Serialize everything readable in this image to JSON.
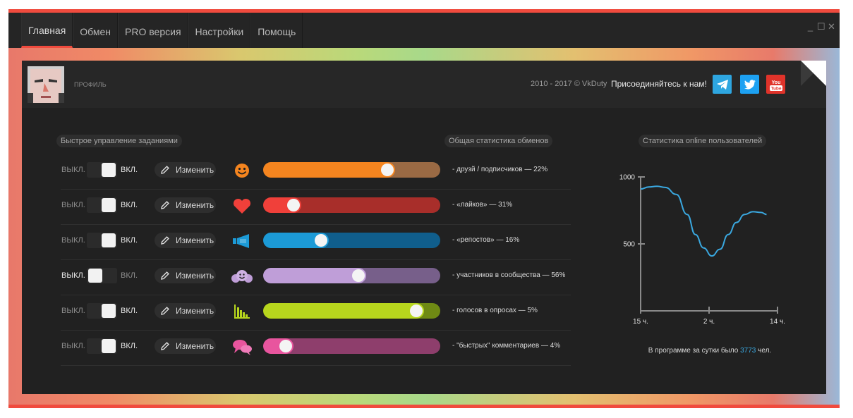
{
  "nav": {
    "tabs": [
      {
        "label": "Главная",
        "active": true
      },
      {
        "label": "Обмен",
        "active": false
      },
      {
        "label": "PRO версия",
        "active": false
      },
      {
        "label": "Настройки",
        "active": false
      },
      {
        "label": "Помощь",
        "active": false
      }
    ],
    "window_controls": [
      "_",
      "☐",
      "✕"
    ]
  },
  "header": {
    "profile_label": "ПРОФИЛЬ",
    "copyright": "2010 - 2017 © VkDuty",
    "join_text": "Присоединяйтесь к нам!",
    "social": [
      {
        "name": "telegram-icon",
        "color": "#2ea6e0"
      },
      {
        "name": "twitter-icon",
        "color": "#1da1f2"
      },
      {
        "name": "youtube-icon",
        "color": "#e0332a",
        "text": "You Tube"
      }
    ]
  },
  "sections": {
    "quick_control": "Быстрое управление заданиями",
    "exchange_stats": "Общая статистика обменов",
    "online_stats": "Статистика online пользователей"
  },
  "labels": {
    "off": "ВЫКЛ.",
    "on": "ВКЛ.",
    "edit": "Изменить"
  },
  "tasks": [
    {
      "icon": "smiley-icon",
      "on": true,
      "slider": 0.72,
      "color": "#f5851f",
      "track": "#9a6a44",
      "stat": "- друзй / подписчиков — 22%"
    },
    {
      "icon": "heart-icon",
      "on": true,
      "slider": 0.14,
      "color": "#f0403a",
      "track": "#a82e2a",
      "stat": "- «лайков» — 31%"
    },
    {
      "icon": "megaphone-icon",
      "on": true,
      "slider": 0.31,
      "color": "#1c9ad6",
      "track": "#105e8c",
      "stat": "- «репостов» — 16%"
    },
    {
      "icon": "group-icon",
      "on": false,
      "slider": 0.54,
      "color": "#bf9ed8",
      "track": "#775f8a",
      "stat": "- участников в сообщества — 56%"
    },
    {
      "icon": "bar-chart-icon",
      "on": true,
      "slider": 0.9,
      "color": "#b7d61d",
      "track": "#6f8a14",
      "stat": "- голосов в опросах — 5%"
    },
    {
      "icon": "chat-bubbles-icon",
      "on": true,
      "slider": 0.09,
      "color": "#e8559e",
      "track": "#8e3e6c",
      "stat": "- \"быстрых\" комментариев — 4%"
    }
  ],
  "online": {
    "note_prefix": "В программе за сутки было",
    "note_count": "3773",
    "note_suffix": "чел."
  },
  "chart_data": {
    "type": "line",
    "title": "Статистика online пользователей",
    "xlabel": "",
    "ylabel": "",
    "x_ticks": [
      "15 ч.",
      "2 ч.",
      "14 ч."
    ],
    "y_ticks": [
      1000,
      500
    ],
    "ylim": [
      0,
      1000
    ],
    "color": "#3aa8e0",
    "points": [
      {
        "x": 0,
        "y": 910
      },
      {
        "x": 0.3,
        "y": 925
      },
      {
        "x": 0.6,
        "y": 930
      },
      {
        "x": 0.9,
        "y": 922
      },
      {
        "x": 1.3,
        "y": 870
      },
      {
        "x": 1.7,
        "y": 720
      },
      {
        "x": 2.0,
        "y": 570
      },
      {
        "x": 2.3,
        "y": 470
      },
      {
        "x": 2.6,
        "y": 410
      },
      {
        "x": 2.9,
        "y": 460
      },
      {
        "x": 3.2,
        "y": 570
      },
      {
        "x": 3.5,
        "y": 660
      },
      {
        "x": 3.8,
        "y": 720
      },
      {
        "x": 4.1,
        "y": 740
      },
      {
        "x": 4.4,
        "y": 735
      },
      {
        "x": 4.6,
        "y": 720
      }
    ],
    "x_range": [
      0,
      5
    ]
  }
}
